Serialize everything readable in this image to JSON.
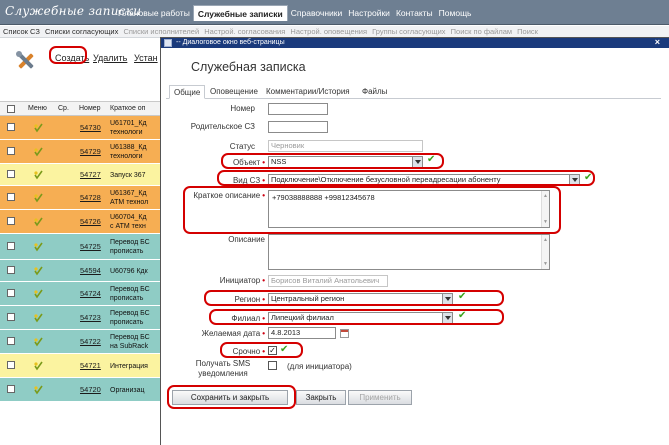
{
  "app": {
    "brand": "Служебные записки",
    "nav": [
      "Плановые работы",
      "Служебные записки",
      "Справочники",
      "Настройки",
      "Контакты",
      "Помощь"
    ],
    "nav_active_index": 1
  },
  "subnav": {
    "items": [
      "Список СЗ",
      "Списки согласующих",
      "Списки исполнителей",
      "Настрой. согласования",
      "Настрой. оповещения",
      "Группы согласующих",
      "Поиск по файлам",
      "Поиск"
    ]
  },
  "toolbar": {
    "create": "Создать",
    "delete": "Удалить",
    "install": "Устан"
  },
  "table": {
    "headers": {
      "menu": "Меню",
      "sr": "Ср.",
      "number": "Номер",
      "summary": "Краткое оп"
    },
    "rows": [
      {
        "number": "54730",
        "desc": "U61701_Кд\nтехнологи",
        "color": "#f6ae53"
      },
      {
        "number": "54729",
        "desc": "U61388_Кд\nтехнологи",
        "color": "#f6ae53"
      },
      {
        "number": "54727",
        "desc": "Запуск 367",
        "color": "#fbf3a0"
      },
      {
        "number": "54728",
        "desc": "U61367_Кд\nATM технол",
        "color": "#f6ae53"
      },
      {
        "number": "54726",
        "desc": "U60704_Кд\nс ATM техн",
        "color": "#f6ae53"
      },
      {
        "number": "54725",
        "desc": "Перевод БС\nпрописать",
        "color": "#8fccc5"
      },
      {
        "number": "54594",
        "desc": "U60796 Кдк",
        "color": "#8fccc5"
      },
      {
        "number": "54724",
        "desc": "Перевод БС\nпрописать",
        "color": "#8fccc5"
      },
      {
        "number": "54723",
        "desc": "Перевод БС\nпрописать",
        "color": "#8fccc5"
      },
      {
        "number": "54722",
        "desc": "Перевод БС\nна SubRack",
        "color": "#8fccc5"
      },
      {
        "number": "54721",
        "desc": "Интеграция",
        "color": "#fbf3a0"
      },
      {
        "number": "54720",
        "desc": "Организац",
        "color": "#8fccc5"
      }
    ]
  },
  "dialog": {
    "title": "-- Диалоговое окно веб-страницы",
    "heading": "Служебная записка",
    "tabs": [
      "Общие",
      "Оповещение",
      "Комментарии/История",
      "Файлы"
    ],
    "fields": {
      "number": {
        "label": "Номер",
        "value": ""
      },
      "parent": {
        "label": "Родительское СЗ",
        "value": ""
      },
      "status": {
        "label": "Статус",
        "value": "Черновик"
      },
      "object": {
        "label": "Объект",
        "value": "NSS"
      },
      "type": {
        "label": "Вид СЗ",
        "value": "Подключение\\Отключение безусловной переадресации абоненту"
      },
      "summary": {
        "label": "Краткое описание",
        "value": "+79038888888 +99812345678"
      },
      "description": {
        "label": "Описание",
        "value": ""
      },
      "initiator": {
        "label": "Инициатор",
        "value": "Борисов Виталий Анатольевич"
      },
      "region": {
        "label": "Регион",
        "value": "Центральный регион"
      },
      "branch": {
        "label": "Филиал",
        "value": "Липецкий филиал"
      },
      "date": {
        "label": "Желаемая дата",
        "value": "4.8.2013"
      },
      "urgent": {
        "label": "Срочно",
        "checked": true
      },
      "sms": {
        "label_line1": "Получать SMS",
        "label_line2": "уведомления",
        "hint": "(для инициатора)"
      }
    },
    "buttons": {
      "save_close": "Сохранить и закрыть",
      "close": "Закрыть",
      "apply": "Применить"
    }
  },
  "colors": {
    "accent_red": "#d40000",
    "check_green": "#3aa31d",
    "title_bar": "#1a3a7c"
  }
}
